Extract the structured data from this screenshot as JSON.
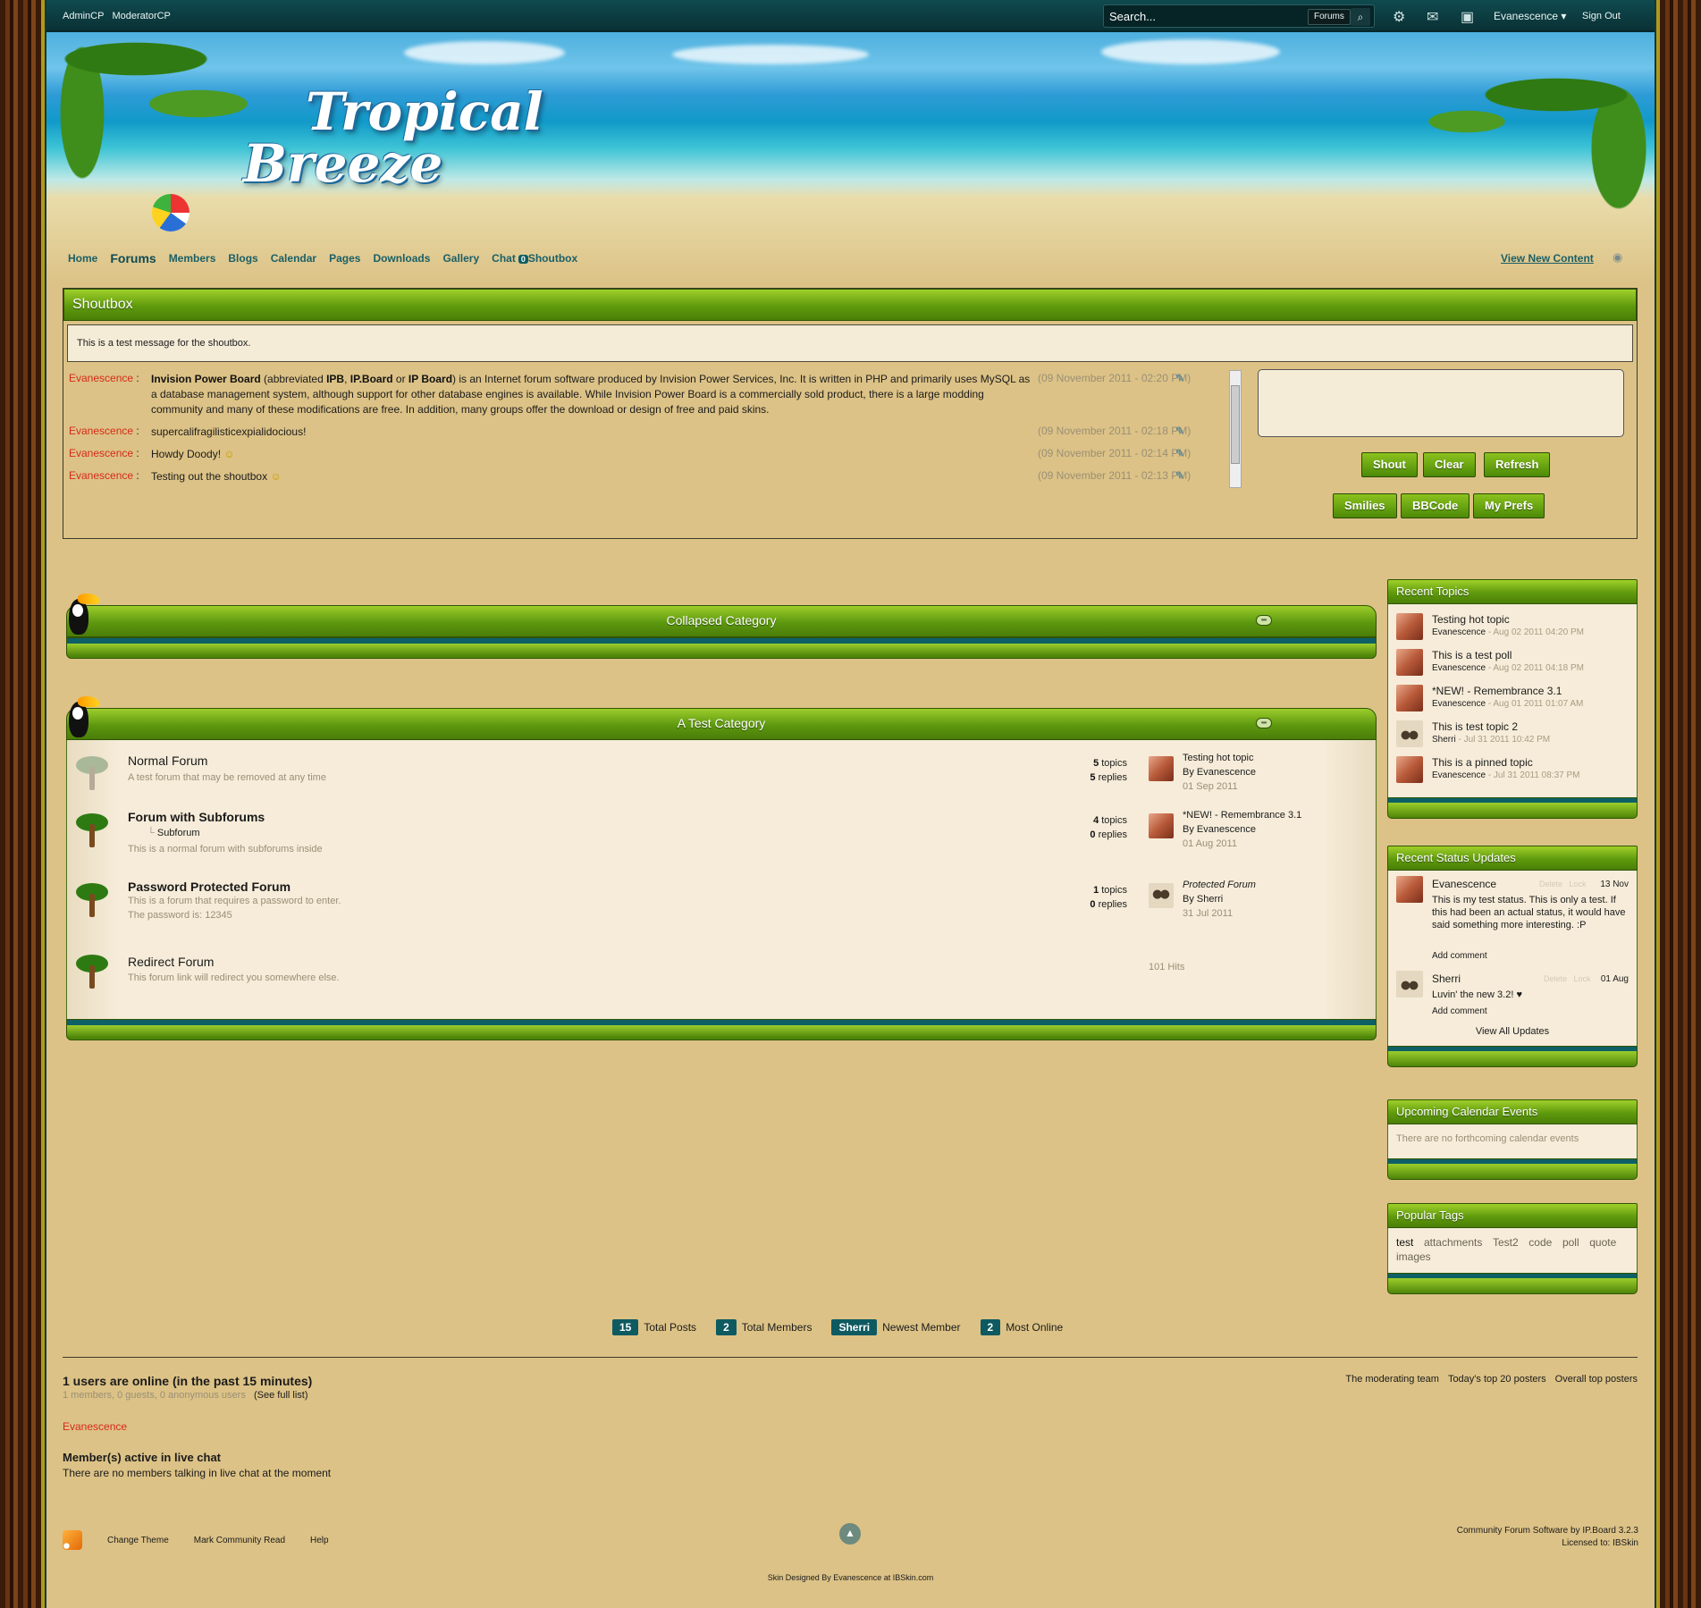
{
  "topbar": {
    "admin_links": [
      "AdminCP",
      "ModeratorCP"
    ],
    "search_placeholder": "Search...",
    "search_scope": "Forums",
    "user_name": "Evanescence",
    "sign_out": "Sign Out"
  },
  "banner": {
    "logo_line1": "Tropical",
    "logo_line2": "Breeze"
  },
  "nav": {
    "items": [
      "Home",
      "Forums",
      "Members",
      "Blogs",
      "Calendar",
      "Pages",
      "Downloads",
      "Gallery",
      "Chat"
    ],
    "chat_badge": "0",
    "shoutbox": "Shoutbox",
    "view_new": "View New Content"
  },
  "shoutbox": {
    "title": "Shoutbox",
    "notice": "This is a test message for the shoutbox.",
    "shouts": [
      {
        "name": "Evanescence",
        "parts": [
          "Invision Power Board",
          " (abbreviated ",
          "IPB",
          ", ",
          "IP.Board",
          " or ",
          "IP Board",
          ") is an Internet forum software produced by Invision Power Services, Inc. It is written in PHP and primarily uses MySQL as a database management system, although support for other database engines is available. While Invision Power Board is a commercially sold product, there is a large modding community and many of these modifications are free. In addition, many groups offer the download or design of free and paid skins."
        ],
        "time": "(09 November 2011 - 02:20 PM)"
      },
      {
        "name": "Evanescence",
        "message": "supercalifragilisticexpialidocious!",
        "time": "(09 November 2011 - 02:18 PM)"
      },
      {
        "name": "Evanescence",
        "message": "Howdy Doody!",
        "time": "(09 November 2011 - 02:14 PM)"
      },
      {
        "name": "Evanescence",
        "message": "Testing out the shoutbox",
        "time": "(09 November 2011 - 02:13 PM)"
      }
    ],
    "buttons": {
      "shout": "Shout",
      "clear": "Clear",
      "refresh": "Refresh",
      "smilies": "Smilies",
      "bbcode": "BBCode",
      "prefs": "My Prefs"
    }
  },
  "categories": {
    "collapsed": {
      "title": "Collapsed Category"
    },
    "test": {
      "title": "A Test Category",
      "forums": [
        {
          "name": "Normal Forum",
          "desc": "A test forum that may be removed at any time",
          "topics": "5",
          "replies": "5",
          "last_title": "Testing hot topic",
          "last_by": "By Evanescence",
          "last_date": "01 Sep 2011"
        },
        {
          "name": "Forum with Subforums",
          "sub": "Subforum",
          "desc": "This is a normal forum with subforums inside",
          "topics": "4",
          "replies": "0",
          "last_title": "*NEW! - Remembrance 3.1",
          "last_by": "By Evanescence",
          "last_date": "01 Aug 2011"
        },
        {
          "name": "Password Protected Forum",
          "desc": "This is a forum that requires a password to enter.",
          "desc2": "The password is: 12345",
          "topics": "1",
          "replies": "0",
          "last_title": "Protected Forum",
          "last_by": "By Sherri",
          "last_date": "31 Jul 2011"
        },
        {
          "name": "Redirect Forum",
          "desc": "This forum link will redirect you somewhere else.",
          "hits": "101 Hits"
        }
      ],
      "topics_label": "topics",
      "replies_label": "replies"
    }
  },
  "sidebar": {
    "recent_topics": {
      "title": "Recent Topics",
      "items": [
        {
          "title": "Testing hot topic",
          "author": "Evanescence",
          "date": " - Aug 02 2011 04:20 PM"
        },
        {
          "title": "This is a test poll",
          "author": "Evanescence",
          "date": " - Aug 02 2011 04:18 PM"
        },
        {
          "title": "*NEW! - Remembrance 3.1",
          "author": "Evanescence",
          "date": " - Aug 01 2011 01:07 AM"
        },
        {
          "title": "This is test topic 2",
          "author": "Sherri",
          "date": " - Jul 31 2011 10:42 PM"
        },
        {
          "title": "This is a pinned topic",
          "author": "Evanescence",
          "date": " - Jul 31 2011 08:37 PM"
        }
      ]
    },
    "status_updates": {
      "title": "Recent Status Updates",
      "delete": "Delete",
      "lock": "Lock",
      "add_comment": "Add comment",
      "view_all": "View All Updates",
      "items": [
        {
          "name": "Evanescence",
          "date": "13 Nov",
          "text": "This is my test status. This is only a test. If this had been an actual status, it would have said something more interesting. :P"
        },
        {
          "name": "Sherri",
          "date": "01 Aug",
          "text": "Luvin' the new 3.2! ♥"
        }
      ]
    },
    "calendar": {
      "title": "Upcoming Calendar Events",
      "empty": "There are no forthcoming calendar events"
    },
    "tags": {
      "title": "Popular Tags",
      "items": [
        "test",
        "attachments",
        "Test2",
        "code",
        "poll",
        "quote",
        "images"
      ]
    }
  },
  "stats": {
    "total_posts": "15",
    "total_posts_label": "Total Posts",
    "total_members": "2",
    "total_members_label": "Total Members",
    "newest_member": "Sherri",
    "newest_member_label": "Newest Member",
    "most_online": "2",
    "most_online_label": "Most Online"
  },
  "online": {
    "title": "1 users are online (in the past 15 minutes)",
    "breakdown": "1 members, 0 guests, 0 anonymous users",
    "full_list": "(See full list)",
    "links": [
      "The moderating team",
      "Today's top 20 posters",
      "Overall top posters"
    ],
    "user": "Evanescence",
    "chat_title": "Member(s) active in live chat",
    "chat_text": "There are no members talking in live chat at the moment"
  },
  "footer": {
    "links": [
      "Change Theme",
      "Mark Community Read",
      "Help"
    ],
    "copyright1": "Community Forum Software by IP.Board 3.2.3",
    "copyright2": "Licensed to: IBSkin",
    "skin_by": "Skin Designed By Evanescence at IBSkin.com"
  },
  "colors": {
    "accent_green": "#5f9a0d",
    "teal": "#0e5a61",
    "name_red": "#d62a1a",
    "page_bg": "#dcc286"
  }
}
